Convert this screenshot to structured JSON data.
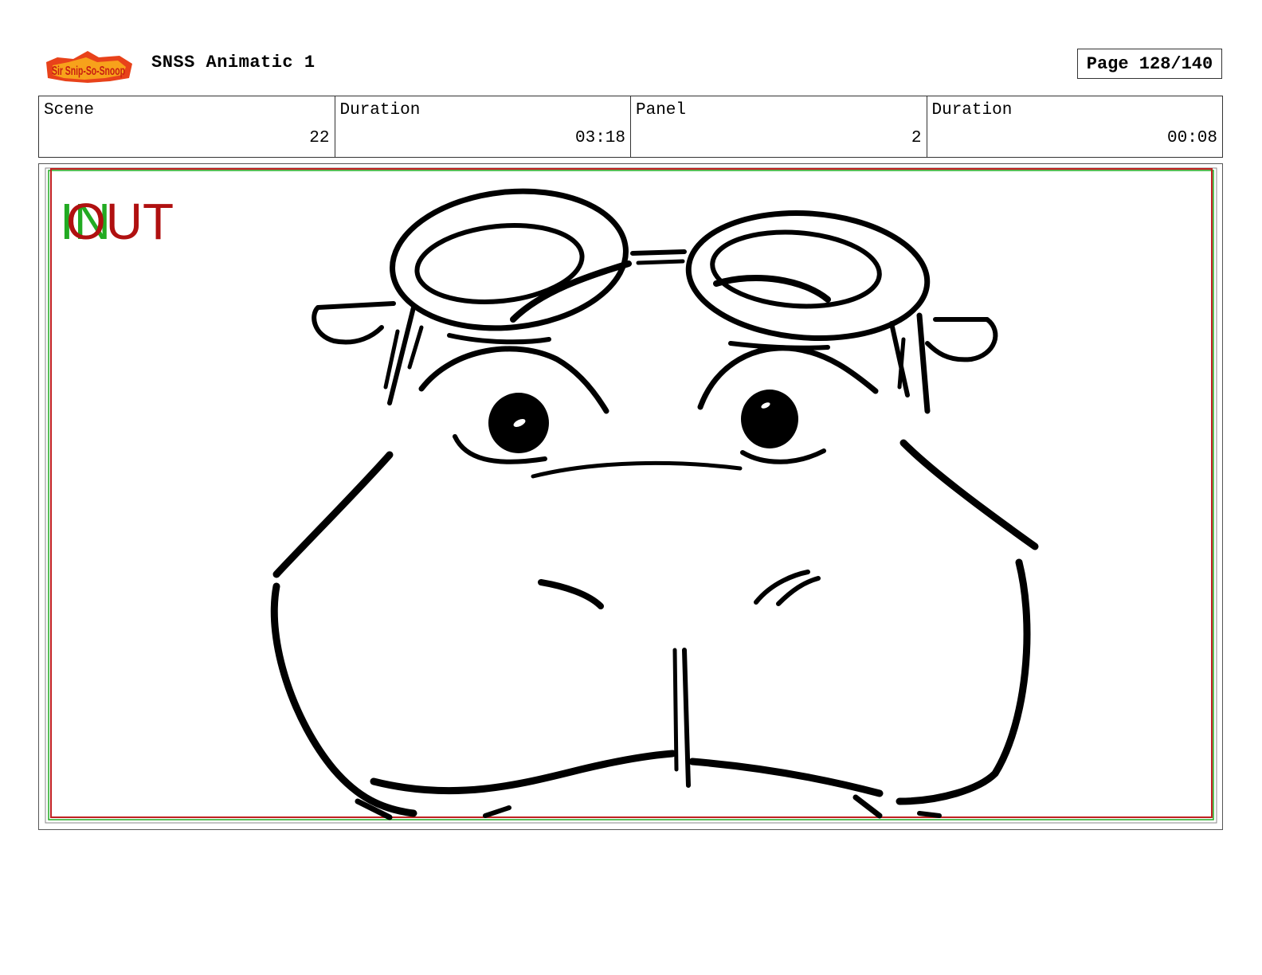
{
  "header": {
    "logo_text": "Sir Snip-So-Snoop",
    "title": "SNSS Animatic 1",
    "page": "Page 128/140"
  },
  "info": {
    "scene_label": "Scene",
    "scene_value": "22",
    "duration_label": "Duration",
    "duration_value": "03:18",
    "panel_label": "Panel",
    "panel_value": "2",
    "panel_duration_label": "Duration",
    "panel_duration_value": "00:08"
  },
  "panel": {
    "in_marker": "IN",
    "out_marker": "OUT",
    "in_color": "#22aa22",
    "out_color": "#b01010",
    "safe_frame_color": "#c02020"
  }
}
